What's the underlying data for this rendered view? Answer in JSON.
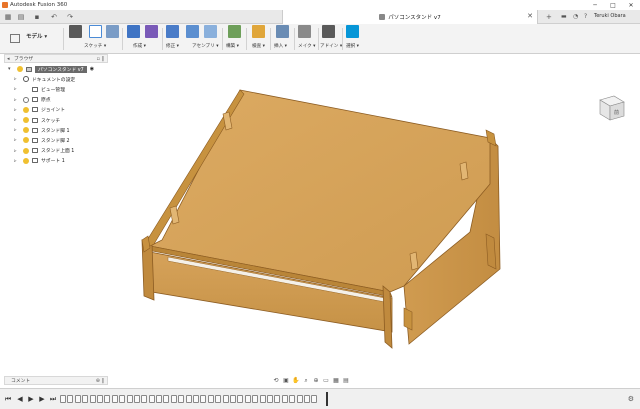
{
  "window": {
    "app_title": "Autodesk Fusion 360",
    "controls": {
      "minimize": "─",
      "maximize": "□",
      "close": "✕"
    }
  },
  "document": {
    "title": "パソコンスタンド v7",
    "close_symbol": "✕"
  },
  "user": {
    "name": "Teruki Obara"
  },
  "toolbar": {
    "workspace": "モデル ▾",
    "groups": [
      {
        "label": "スケッチ ▾"
      },
      {
        "label": "作成 ▾"
      },
      {
        "label": "修正 ▾"
      },
      {
        "label": "アセンブリ ▾"
      },
      {
        "label": "構築 ▾"
      },
      {
        "label": "検査 ▾"
      },
      {
        "label": "挿入 ▾"
      },
      {
        "label": "メイク ▾"
      },
      {
        "label": "アドイン ▾"
      },
      {
        "label": "選択 ▾"
      }
    ]
  },
  "browser": {
    "title": "ブラウザ",
    "items": [
      {
        "label": "パソコンスタンド v7",
        "type": "root"
      },
      {
        "label": "ドキュメントの設定",
        "type": "settings"
      },
      {
        "label": "ビュー管理",
        "type": "folder"
      },
      {
        "label": "原点",
        "type": "folder"
      },
      {
        "label": "ジョイント",
        "type": "folder"
      },
      {
        "label": "スケッチ",
        "type": "folder"
      },
      {
        "label": "スタンド脚 1",
        "type": "component"
      },
      {
        "label": "スタンド脚 2",
        "type": "component"
      },
      {
        "label": "スタンド上面 1",
        "type": "component"
      },
      {
        "label": "サポート 1",
        "type": "component"
      }
    ]
  },
  "comments": {
    "title": "コメント"
  },
  "colors": {
    "wood_light": "#d9a75f",
    "wood_mid": "#c99547",
    "wood_dark": "#b07a33",
    "wood_edge": "#8c5c22",
    "accent_blue": "#0696d7"
  }
}
